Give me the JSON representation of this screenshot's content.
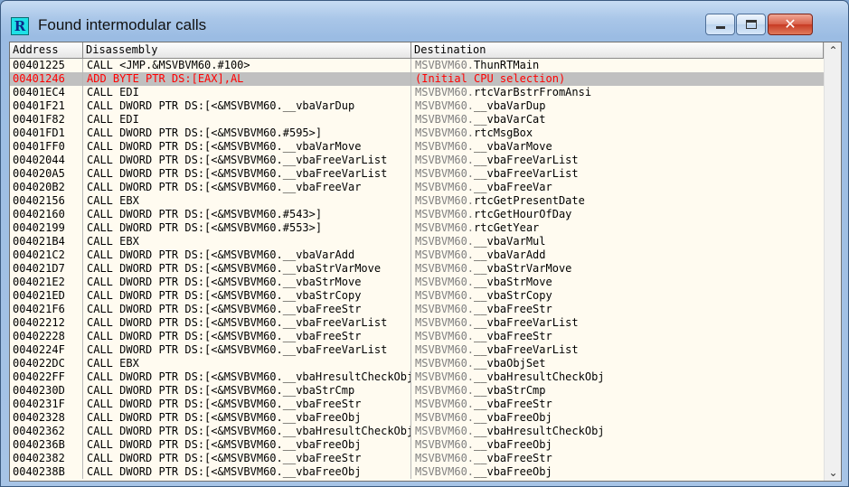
{
  "window": {
    "title": "Found intermodular calls",
    "icon_letter": "R",
    "close_glyph": "✕"
  },
  "columns": {
    "address": "Address",
    "disassembly": "Disassembly",
    "destination": "Destination"
  },
  "selected_index": 1,
  "rows": [
    {
      "address": "00401225",
      "disassembly": "CALL <JMP.&MSVBVM60.#100>",
      "module": "MSVBVM60.",
      "func": "ThunRTMain"
    },
    {
      "address": "00401246",
      "disassembly": "ADD BYTE PTR DS:[EAX],AL",
      "module": "",
      "func": "(Initial CPU selection)"
    },
    {
      "address": "00401EC4",
      "disassembly": "CALL EDI",
      "module": "MSVBVM60.",
      "func": "rtcVarBstrFromAnsi"
    },
    {
      "address": "00401F21",
      "disassembly": "CALL DWORD PTR DS:[<&MSVBVM60.__vbaVarDup",
      "module": "MSVBVM60.",
      "func": "__vbaVarDup"
    },
    {
      "address": "00401F82",
      "disassembly": "CALL EDI",
      "module": "MSVBVM60.",
      "func": "__vbaVarCat"
    },
    {
      "address": "00401FD1",
      "disassembly": "CALL DWORD PTR DS:[<&MSVBVM60.#595>]",
      "module": "MSVBVM60.",
      "func": "rtcMsgBox"
    },
    {
      "address": "00401FF0",
      "disassembly": "CALL DWORD PTR DS:[<&MSVBVM60.__vbaVarMove",
      "module": "MSVBVM60.",
      "func": "__vbaVarMove"
    },
    {
      "address": "00402044",
      "disassembly": "CALL DWORD PTR DS:[<&MSVBVM60.__vbaFreeVarList",
      "module": "MSVBVM60.",
      "func": "__vbaFreeVarList"
    },
    {
      "address": "004020A5",
      "disassembly": "CALL DWORD PTR DS:[<&MSVBVM60.__vbaFreeVarList",
      "module": "MSVBVM60.",
      "func": "__vbaFreeVarList"
    },
    {
      "address": "004020B2",
      "disassembly": "CALL DWORD PTR DS:[<&MSVBVM60.__vbaFreeVar",
      "module": "MSVBVM60.",
      "func": "__vbaFreeVar"
    },
    {
      "address": "00402156",
      "disassembly": "CALL EBX",
      "module": "MSVBVM60.",
      "func": "rtcGetPresentDate"
    },
    {
      "address": "00402160",
      "disassembly": "CALL DWORD PTR DS:[<&MSVBVM60.#543>]",
      "module": "MSVBVM60.",
      "func": "rtcGetHourOfDay"
    },
    {
      "address": "00402199",
      "disassembly": "CALL DWORD PTR DS:[<&MSVBVM60.#553>]",
      "module": "MSVBVM60.",
      "func": "rtcGetYear"
    },
    {
      "address": "004021B4",
      "disassembly": "CALL EBX",
      "module": "MSVBVM60.",
      "func": "__vbaVarMul"
    },
    {
      "address": "004021C2",
      "disassembly": "CALL DWORD PTR DS:[<&MSVBVM60.__vbaVarAdd",
      "module": "MSVBVM60.",
      "func": "__vbaVarAdd"
    },
    {
      "address": "004021D7",
      "disassembly": "CALL DWORD PTR DS:[<&MSVBVM60.__vbaStrVarMove",
      "module": "MSVBVM60.",
      "func": "__vbaStrVarMove"
    },
    {
      "address": "004021E2",
      "disassembly": "CALL DWORD PTR DS:[<&MSVBVM60.__vbaStrMove",
      "module": "MSVBVM60.",
      "func": "__vbaStrMove"
    },
    {
      "address": "004021ED",
      "disassembly": "CALL DWORD PTR DS:[<&MSVBVM60.__vbaStrCopy",
      "module": "MSVBVM60.",
      "func": "__vbaStrCopy"
    },
    {
      "address": "004021F6",
      "disassembly": "CALL DWORD PTR DS:[<&MSVBVM60.__vbaFreeStr",
      "module": "MSVBVM60.",
      "func": "__vbaFreeStr"
    },
    {
      "address": "00402212",
      "disassembly": "CALL DWORD PTR DS:[<&MSVBVM60.__vbaFreeVarList",
      "module": "MSVBVM60.",
      "func": "__vbaFreeVarList"
    },
    {
      "address": "00402228",
      "disassembly": "CALL DWORD PTR DS:[<&MSVBVM60.__vbaFreeStr",
      "module": "MSVBVM60.",
      "func": "__vbaFreeStr"
    },
    {
      "address": "0040224F",
      "disassembly": "CALL DWORD PTR DS:[<&MSVBVM60.__vbaFreeVarList",
      "module": "MSVBVM60.",
      "func": "__vbaFreeVarList"
    },
    {
      "address": "004022DC",
      "disassembly": "CALL EBX",
      "module": "MSVBVM60.",
      "func": "__vbaObjSet"
    },
    {
      "address": "004022FF",
      "disassembly": "CALL DWORD PTR DS:[<&MSVBVM60.__vbaHresultCheckObj",
      "module": "MSVBVM60.",
      "func": "__vbaHresultCheckObj"
    },
    {
      "address": "0040230D",
      "disassembly": "CALL DWORD PTR DS:[<&MSVBVM60.__vbaStrCmp",
      "module": "MSVBVM60.",
      "func": "__vbaStrCmp"
    },
    {
      "address": "0040231F",
      "disassembly": "CALL DWORD PTR DS:[<&MSVBVM60.__vbaFreeStr",
      "module": "MSVBVM60.",
      "func": "__vbaFreeStr"
    },
    {
      "address": "00402328",
      "disassembly": "CALL DWORD PTR DS:[<&MSVBVM60.__vbaFreeObj",
      "module": "MSVBVM60.",
      "func": "__vbaFreeObj"
    },
    {
      "address": "00402362",
      "disassembly": "CALL DWORD PTR DS:[<&MSVBVM60.__vbaHresultCheckObj",
      "module": "MSVBVM60.",
      "func": "__vbaHresultCheckObj"
    },
    {
      "address": "0040236B",
      "disassembly": "CALL DWORD PTR DS:[<&MSVBVM60.__vbaFreeObj",
      "module": "MSVBVM60.",
      "func": "__vbaFreeObj"
    },
    {
      "address": "00402382",
      "disassembly": "CALL DWORD PTR DS:[<&MSVBVM60.__vbaFreeStr",
      "module": "MSVBVM60.",
      "func": "__vbaFreeStr"
    },
    {
      "address": "0040238B",
      "disassembly": "CALL DWORD PTR DS:[<&MSVBVM60.__vbaFreeObj",
      "module": "MSVBVM60.",
      "func": "__vbaFreeObj"
    }
  ],
  "scrollbar": {
    "up_glyph": "⌃",
    "down_glyph": "⌄"
  },
  "colors": {
    "selected_text": "#ff0000",
    "selected_bg": "#c0c0c0",
    "list_bg": "#fffbf0",
    "module_text": "#808080"
  }
}
